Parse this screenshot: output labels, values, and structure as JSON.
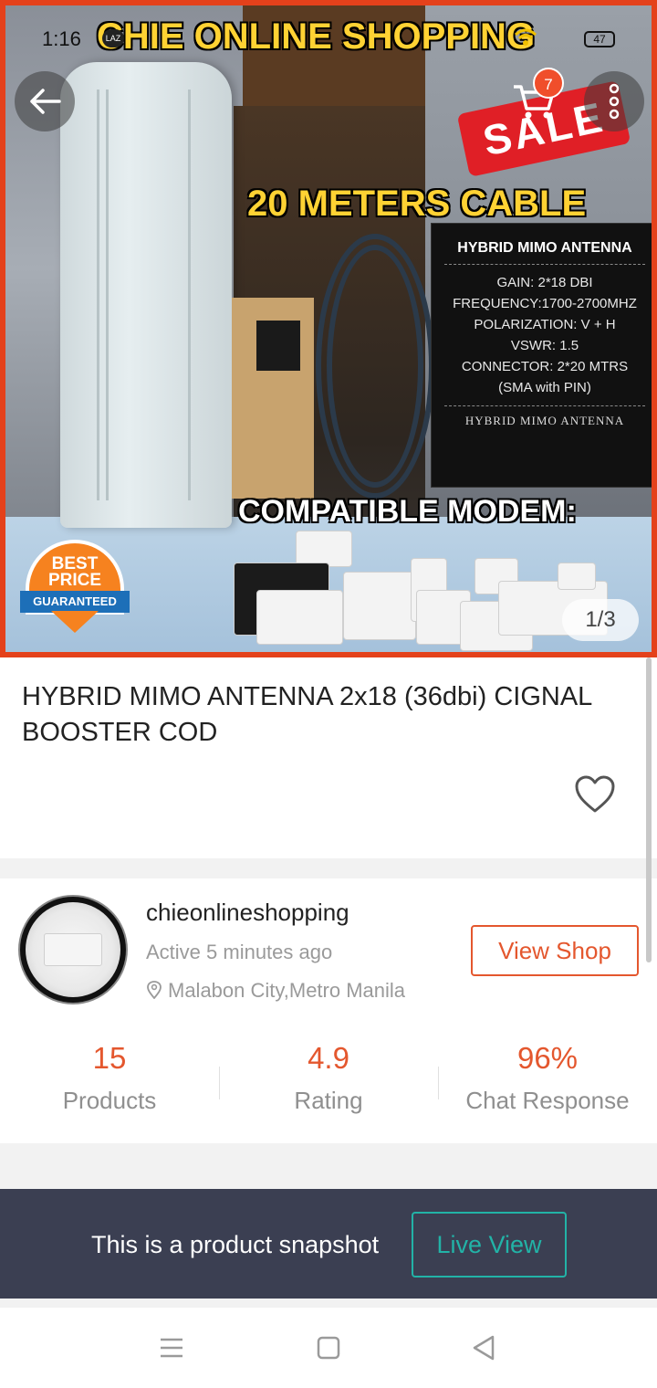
{
  "status_bar": {
    "time": "1:16",
    "app_badge": "LAZ",
    "battery": "47"
  },
  "hero": {
    "banner_top": "CHIE ONLINE SHOPPING",
    "banner_mid": "20 METERS CABLE",
    "banner_low": "COMPATIBLE MODEM:",
    "sale_text": "SALE",
    "badge_best": "BEST",
    "badge_price": "PRICE",
    "badge_guaranteed": "GUARANTEED",
    "spec_title": "HYBRID MIMO ANTENNA",
    "spec_lines": [
      "GAIN: 2*18 DBI",
      "FREQUENCY:1700-2700MHZ",
      "POLARIZATION: V + H",
      "VSWR: 1.5",
      "CONNECTOR: 2*20 MTRS",
      "(SMA with PIN)"
    ],
    "spec_footer": "HYBRID MIMO ANTENNA",
    "pager": "1/3"
  },
  "nav": {
    "cart_count": "7",
    "back_icon": "arrow-left-icon",
    "cart_icon": "cart-icon",
    "more_icon": "more-vertical-icon"
  },
  "product": {
    "title": "HYBRID MIMO ANTENNA 2x18 (36dbi) CIGNAL BOOSTER COD",
    "wishlist_icon": "heart-icon"
  },
  "shop": {
    "name": "chieonlineshopping",
    "active": "Active 5 minutes ago",
    "location": "Malabon City,Metro Manila",
    "view_shop_label": "View Shop",
    "stats": [
      {
        "value": "15",
        "label": "Products"
      },
      {
        "value": "4.9",
        "label": "Rating"
      },
      {
        "value": "96%",
        "label": "Chat Response"
      }
    ]
  },
  "snapshot": {
    "text": "This is a product snapshot",
    "button_label": "Live View"
  },
  "colors": {
    "accent": "#e4572e",
    "teal": "#22b3a7",
    "snapshot_bg": "#3b3f52"
  }
}
